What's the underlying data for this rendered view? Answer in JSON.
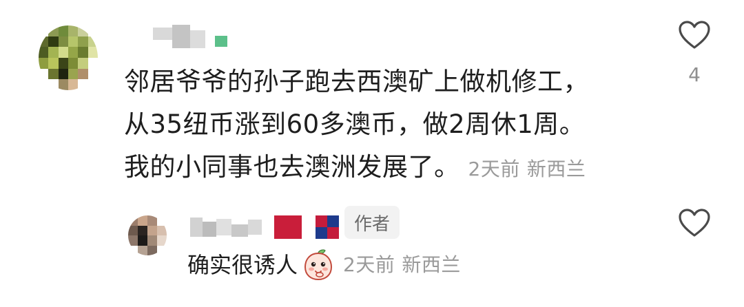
{
  "comment": {
    "lines": [
      "邻居爷爷的孙子跑去西澳矿上做机修工，",
      "从35纽币涨到60多澳币，做2周休1周。",
      "我的小同事也去澳洲发展了。"
    ],
    "time": "2天前",
    "location": "新西兰",
    "like_count": "4"
  },
  "reply": {
    "badge": "作者",
    "text": "确实很诱人",
    "emoji": "peach-face-emoji",
    "time": "2天前",
    "location": "新西兰"
  },
  "icons": {
    "like": "heart-outline-icon"
  },
  "colors": {
    "text": "#1e1e1e",
    "meta": "#9a9a9a",
    "badge_bg": "#f2f2f2",
    "badge_text": "#6b6b6b",
    "icon": "#4a4a4a"
  }
}
